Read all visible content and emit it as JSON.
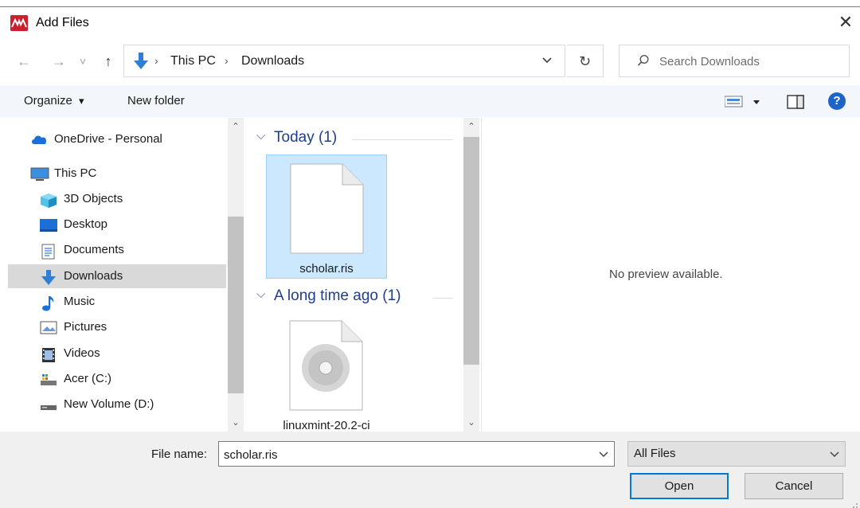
{
  "window": {
    "title": "Add Files",
    "close_glyph": "✕"
  },
  "nav": {
    "back_glyph": "←",
    "forward_glyph": "→",
    "recent_glyph": "˅",
    "up_glyph": "↑"
  },
  "address": {
    "crumbs": [
      "This PC",
      "Downloads"
    ],
    "sep_glyph": "›",
    "drop_glyph": "⌄",
    "refresh_glyph": "↻"
  },
  "search": {
    "placeholder": "Search Downloads"
  },
  "toolbar": {
    "organize_label": "Organize",
    "new_folder_label": "New folder",
    "caret_glyph": "▾",
    "help_glyph": "?"
  },
  "sidebar": {
    "items": [
      {
        "label": "OneDrive - Personal",
        "icon": "cloud-icon"
      },
      {
        "label": "This PC",
        "icon": "computer-icon"
      },
      {
        "label": "3D Objects",
        "icon": "cube-icon"
      },
      {
        "label": "Desktop",
        "icon": "desktop-icon"
      },
      {
        "label": "Documents",
        "icon": "document-icon"
      },
      {
        "label": "Downloads",
        "icon": "download-icon",
        "selected": true
      },
      {
        "label": "Music",
        "icon": "music-note-icon"
      },
      {
        "label": "Pictures",
        "icon": "pictures-icon"
      },
      {
        "label": "Videos",
        "icon": "film-icon"
      },
      {
        "label": "Acer (C:)",
        "icon": "drive-c-icon"
      },
      {
        "label": "New Volume (D:)",
        "icon": "drive-icon"
      }
    ]
  },
  "files": {
    "groups": [
      {
        "header": "Today (1)",
        "items": [
          {
            "name": "scholar.ris",
            "icon": "blank-file-icon",
            "selected": true
          }
        ]
      },
      {
        "header": "A long time ago (1)",
        "items": [
          {
            "name": "linuxmint-20.2-ci",
            "icon": "disc-image-icon"
          }
        ]
      }
    ],
    "group_chevron": "⌵"
  },
  "preview": {
    "text": "No preview available."
  },
  "footer": {
    "file_name_label": "File name:",
    "file_name_value": "scholar.ris",
    "file_type": "All Files",
    "open_label": "Open",
    "cancel_label": "Cancel",
    "drop_glyph": "⌄"
  },
  "scroll": {
    "up_glyph": "⌃",
    "down_glyph": "⌄"
  },
  "colors": {
    "accent": "#0078d7",
    "app_logo": "#c8202c",
    "selection": "#cce8ff",
    "group_header": "#1e3d8c"
  }
}
